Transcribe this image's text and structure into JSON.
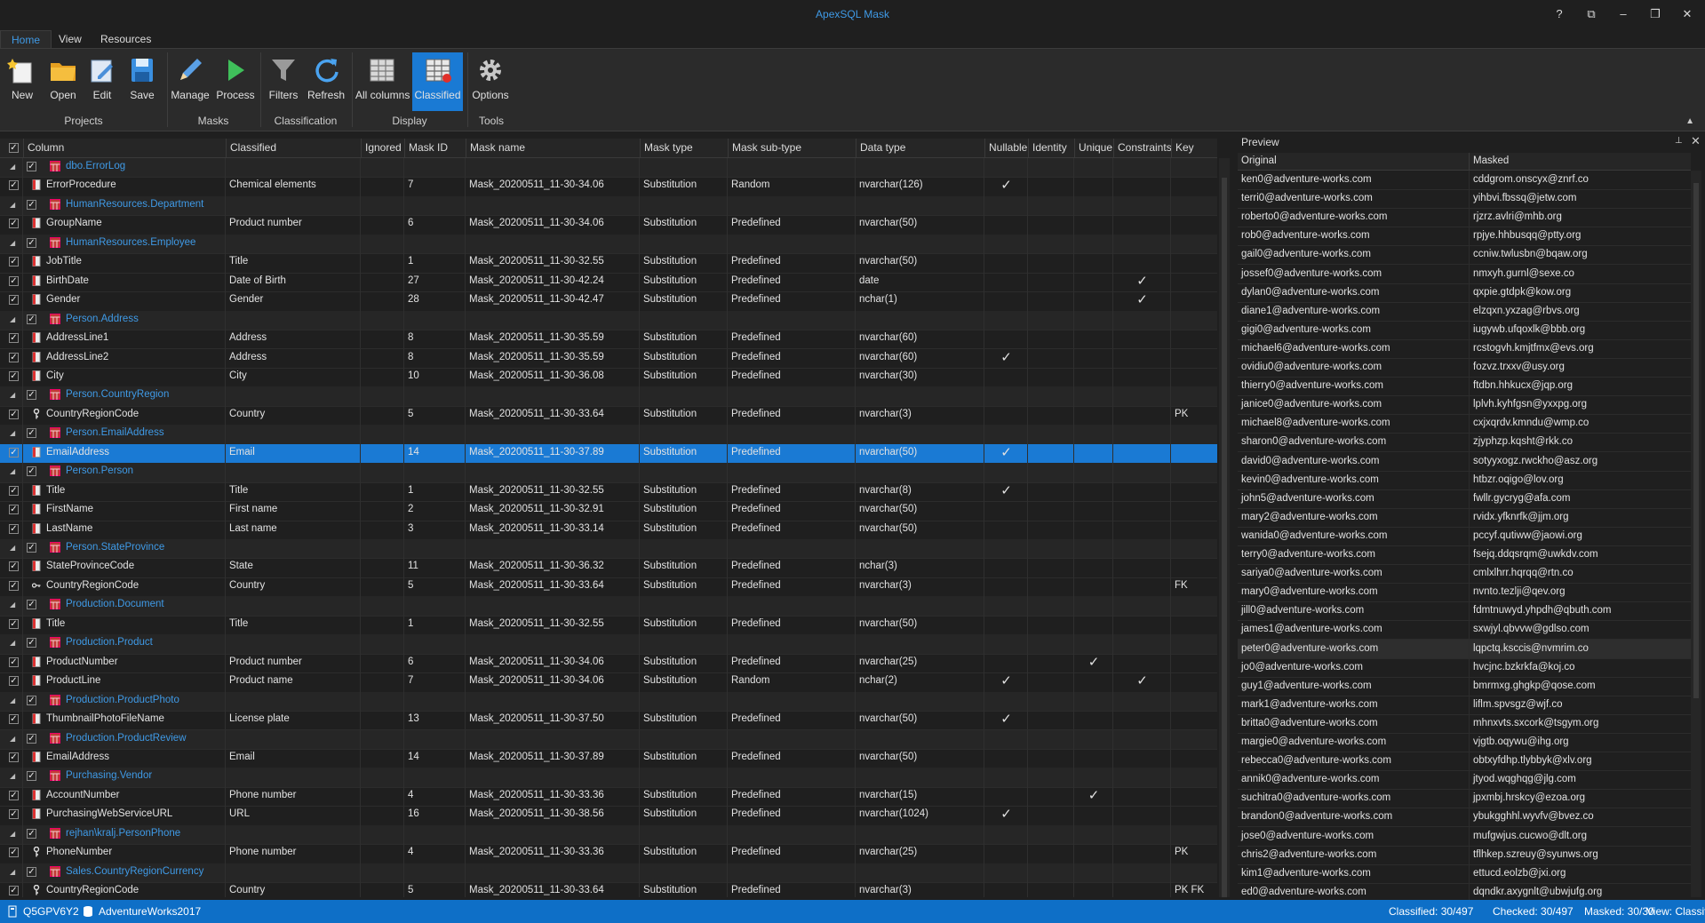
{
  "app_title": "ApexSQL Mask",
  "window_buttons": [
    "?",
    "⧉",
    "–",
    "❐",
    "✕"
  ],
  "tabs": [
    "Home",
    "View",
    "Resources"
  ],
  "ribbon": {
    "buttons": {
      "new": "New",
      "open": "Open",
      "edit": "Edit",
      "save": "Save",
      "manage": "Manage",
      "process": "Process",
      "filters": "Filters",
      "refresh": "Refresh",
      "all_columns": "All columns",
      "classified": "Classified",
      "options": "Options"
    },
    "groups": {
      "projects": "Projects",
      "masks": "Masks",
      "classification": "Classification",
      "display": "Display",
      "tools": "Tools"
    }
  },
  "grid": {
    "headers": [
      "Column",
      "Classified",
      "Ignored",
      "Mask ID",
      "Mask name",
      "Mask type",
      "Mask sub-type",
      "Data type",
      "Nullable",
      "Identity",
      "Unique",
      "Constraints",
      "Key"
    ],
    "rows": [
      {
        "group": true,
        "name": "dbo.ErrorLog"
      },
      {
        "col": "ErrorProcedure",
        "cls": "Chemical elements",
        "id": "7",
        "mask": "Mask_20200511_11-30-34.06",
        "type": "Substitution",
        "sub": "Random",
        "dt": "nvarchar(126)",
        "nullable": "✓",
        "unique": "",
        "cons": "",
        "key": "",
        "icon": "col"
      },
      {
        "group": true,
        "name": "HumanResources.Department"
      },
      {
        "col": "GroupName",
        "cls": "Product number",
        "id": "6",
        "mask": "Mask_20200511_11-30-34.06",
        "type": "Substitution",
        "sub": "Predefined",
        "dt": "nvarchar(50)",
        "nullable": "",
        "unique": "",
        "cons": "",
        "key": "",
        "icon": "col"
      },
      {
        "group": true,
        "name": "HumanResources.Employee"
      },
      {
        "col": "JobTitle",
        "cls": "Title",
        "id": "1",
        "mask": "Mask_20200511_11-30-32.55",
        "type": "Substitution",
        "sub": "Predefined",
        "dt": "nvarchar(50)",
        "nullable": "",
        "unique": "",
        "cons": "",
        "key": "",
        "icon": "col"
      },
      {
        "col": "BirthDate",
        "cls": "Date of Birth",
        "id": "27",
        "mask": "Mask_20200511_11-30-42.24",
        "type": "Substitution",
        "sub": "Predefined",
        "dt": "date",
        "nullable": "",
        "unique": "",
        "cons": "✓",
        "key": "",
        "icon": "col"
      },
      {
        "col": "Gender",
        "cls": "Gender",
        "id": "28",
        "mask": "Mask_20200511_11-30-42.47",
        "type": "Substitution",
        "sub": "Predefined",
        "dt": "nchar(1)",
        "nullable": "",
        "unique": "",
        "cons": "✓",
        "key": "",
        "icon": "col"
      },
      {
        "group": true,
        "name": "Person.Address"
      },
      {
        "col": "AddressLine1",
        "cls": "Address",
        "id": "8",
        "mask": "Mask_20200511_11-30-35.59",
        "type": "Substitution",
        "sub": "Predefined",
        "dt": "nvarchar(60)",
        "nullable": "",
        "unique": "",
        "cons": "",
        "key": "",
        "icon": "col"
      },
      {
        "col": "AddressLine2",
        "cls": "Address",
        "id": "8",
        "mask": "Mask_20200511_11-30-35.59",
        "type": "Substitution",
        "sub": "Predefined",
        "dt": "nvarchar(60)",
        "nullable": "✓",
        "unique": "",
        "cons": "",
        "key": "",
        "icon": "col"
      },
      {
        "col": "City",
        "cls": "City",
        "id": "10",
        "mask": "Mask_20200511_11-30-36.08",
        "type": "Substitution",
        "sub": "Predefined",
        "dt": "nvarchar(30)",
        "nullable": "",
        "unique": "",
        "cons": "",
        "key": "",
        "icon": "col"
      },
      {
        "group": true,
        "name": "Person.CountryRegion"
      },
      {
        "col": "CountryRegionCode",
        "cls": "Country",
        "id": "5",
        "mask": "Mask_20200511_11-30-33.64",
        "type": "Substitution",
        "sub": "Predefined",
        "dt": "nvarchar(3)",
        "nullable": "",
        "unique": "",
        "cons": "",
        "key": "PK",
        "icon": "pk"
      },
      {
        "group": true,
        "name": "Person.EmailAddress"
      },
      {
        "col": "EmailAddress",
        "cls": "Email",
        "id": "14",
        "mask": "Mask_20200511_11-30-37.89",
        "type": "Substitution",
        "sub": "Predefined",
        "dt": "nvarchar(50)",
        "nullable": "✓",
        "unique": "",
        "cons": "",
        "key": "",
        "icon": "col",
        "sel": true
      },
      {
        "group": true,
        "name": "Person.Person"
      },
      {
        "col": "Title",
        "cls": "Title",
        "id": "1",
        "mask": "Mask_20200511_11-30-32.55",
        "type": "Substitution",
        "sub": "Predefined",
        "dt": "nvarchar(8)",
        "nullable": "✓",
        "unique": "",
        "cons": "",
        "key": "",
        "icon": "col"
      },
      {
        "col": "FirstName",
        "cls": "First name",
        "id": "2",
        "mask": "Mask_20200511_11-30-32.91",
        "type": "Substitution",
        "sub": "Predefined",
        "dt": "nvarchar(50)",
        "nullable": "",
        "unique": "",
        "cons": "",
        "key": "",
        "icon": "col"
      },
      {
        "col": "LastName",
        "cls": "Last name",
        "id": "3",
        "mask": "Mask_20200511_11-30-33.14",
        "type": "Substitution",
        "sub": "Predefined",
        "dt": "nvarchar(50)",
        "nullable": "",
        "unique": "",
        "cons": "",
        "key": "",
        "icon": "col"
      },
      {
        "group": true,
        "name": "Person.StateProvince"
      },
      {
        "col": "StateProvinceCode",
        "cls": "State",
        "id": "11",
        "mask": "Mask_20200511_11-30-36.32",
        "type": "Substitution",
        "sub": "Predefined",
        "dt": "nchar(3)",
        "nullable": "",
        "unique": "",
        "cons": "",
        "key": "",
        "icon": "col"
      },
      {
        "col": "CountryRegionCode",
        "cls": "Country",
        "id": "5",
        "mask": "Mask_20200511_11-30-33.64",
        "type": "Substitution",
        "sub": "Predefined",
        "dt": "nvarchar(3)",
        "nullable": "",
        "unique": "",
        "cons": "",
        "key": "FK",
        "icon": "fk"
      },
      {
        "group": true,
        "name": "Production.Document"
      },
      {
        "col": "Title",
        "cls": "Title",
        "id": "1",
        "mask": "Mask_20200511_11-30-32.55",
        "type": "Substitution",
        "sub": "Predefined",
        "dt": "nvarchar(50)",
        "nullable": "",
        "unique": "",
        "cons": "",
        "key": "",
        "icon": "col"
      },
      {
        "group": true,
        "name": "Production.Product"
      },
      {
        "col": "ProductNumber",
        "cls": "Product number",
        "id": "6",
        "mask": "Mask_20200511_11-30-34.06",
        "type": "Substitution",
        "sub": "Predefined",
        "dt": "nvarchar(25)",
        "nullable": "",
        "unique": "✓",
        "cons": "",
        "key": "",
        "icon": "col"
      },
      {
        "col": "ProductLine",
        "cls": "Product name",
        "id": "7",
        "mask": "Mask_20200511_11-30-34.06",
        "type": "Substitution",
        "sub": "Random",
        "dt": "nchar(2)",
        "nullable": "✓",
        "unique": "",
        "cons": "✓",
        "key": "",
        "icon": "col"
      },
      {
        "group": true,
        "name": "Production.ProductPhoto"
      },
      {
        "col": "ThumbnailPhotoFileName",
        "cls": "License plate",
        "id": "13",
        "mask": "Mask_20200511_11-30-37.50",
        "type": "Substitution",
        "sub": "Predefined",
        "dt": "nvarchar(50)",
        "nullable": "✓",
        "unique": "",
        "cons": "",
        "key": "",
        "icon": "col"
      },
      {
        "group": true,
        "name": "Production.ProductReview"
      },
      {
        "col": "EmailAddress",
        "cls": "Email",
        "id": "14",
        "mask": "Mask_20200511_11-30-37.89",
        "type": "Substitution",
        "sub": "Predefined",
        "dt": "nvarchar(50)",
        "nullable": "",
        "unique": "",
        "cons": "",
        "key": "",
        "icon": "col"
      },
      {
        "group": true,
        "name": "Purchasing.Vendor"
      },
      {
        "col": "AccountNumber",
        "cls": "Phone number",
        "id": "4",
        "mask": "Mask_20200511_11-30-33.36",
        "type": "Substitution",
        "sub": "Predefined",
        "dt": "nvarchar(15)",
        "nullable": "",
        "unique": "✓",
        "cons": "",
        "key": "",
        "icon": "col"
      },
      {
        "col": "PurchasingWebServiceURL",
        "cls": "URL",
        "id": "16",
        "mask": "Mask_20200511_11-30-38.56",
        "type": "Substitution",
        "sub": "Predefined",
        "dt": "nvarchar(1024)",
        "nullable": "✓",
        "unique": "",
        "cons": "",
        "key": "",
        "icon": "col"
      },
      {
        "group": true,
        "name": "rejhan\\kralj.PersonPhone"
      },
      {
        "col": "PhoneNumber",
        "cls": "Phone number",
        "id": "4",
        "mask": "Mask_20200511_11-30-33.36",
        "type": "Substitution",
        "sub": "Predefined",
        "dt": "nvarchar(25)",
        "nullable": "",
        "unique": "",
        "cons": "",
        "key": "PK",
        "icon": "pk"
      },
      {
        "group": true,
        "name": "Sales.CountryRegionCurrency"
      },
      {
        "col": "CountryRegionCode",
        "cls": "Country",
        "id": "5",
        "mask": "Mask_20200511_11-30-33.64",
        "type": "Substitution",
        "sub": "Predefined",
        "dt": "nvarchar(3)",
        "nullable": "",
        "unique": "",
        "cons": "",
        "key": "PK FK",
        "icon": "pk"
      }
    ]
  },
  "preview": {
    "title": "Preview",
    "headers": [
      "Original",
      "Masked"
    ],
    "rows": [
      [
        "ken0@adventure-works.com",
        "cddgrom.onscyx@znrf.co"
      ],
      [
        "terri0@adventure-works.com",
        "yihbvi.fbssq@jetw.com"
      ],
      [
        "roberto0@adventure-works.com",
        "rjzrz.avlri@mhb.org"
      ],
      [
        "rob0@adventure-works.com",
        "rpjye.hhbusqq@ptty.org"
      ],
      [
        "gail0@adventure-works.com",
        "ccniw.twlusbn@bqaw.org"
      ],
      [
        "jossef0@adventure-works.com",
        "nmxyh.gurnl@sexe.co"
      ],
      [
        "dylan0@adventure-works.com",
        "qxpie.gtdpk@kow.org"
      ],
      [
        "diane1@adventure-works.com",
        "elzqxn.yxzag@rbvs.org"
      ],
      [
        "gigi0@adventure-works.com",
        "iugywb.ufqoxlk@bbb.org"
      ],
      [
        "michael6@adventure-works.com",
        "rcstogvh.kmjtfmx@evs.org"
      ],
      [
        "ovidiu0@adventure-works.com",
        "fozvz.trxxv@usy.org"
      ],
      [
        "thierry0@adventure-works.com",
        "ftdbn.hhkucx@jqp.org"
      ],
      [
        "janice0@adventure-works.com",
        "lplvh.kyhfgsn@yxxpg.org"
      ],
      [
        "michael8@adventure-works.com",
        "cxjxqrdv.kmndu@wmp.co"
      ],
      [
        "sharon0@adventure-works.com",
        "zjyphzp.kqsht@rkk.co"
      ],
      [
        "david0@adventure-works.com",
        "sotyyxogz.rwckho@asz.org"
      ],
      [
        "kevin0@adventure-works.com",
        "htbzr.oqigo@lov.org"
      ],
      [
        "john5@adventure-works.com",
        "fwllr.gycryg@afa.com"
      ],
      [
        "mary2@adventure-works.com",
        "rvidx.yfknrfk@jjm.org"
      ],
      [
        "wanida0@adventure-works.com",
        "pccyf.qutiww@jaowi.org"
      ],
      [
        "terry0@adventure-works.com",
        "fsejq.ddqsrqm@uwkdv.com"
      ],
      [
        "sariya0@adventure-works.com",
        "cmlxlhrr.hqrqq@rtn.co"
      ],
      [
        "mary0@adventure-works.com",
        "nvnto.tezlji@qev.org"
      ],
      [
        "jill0@adventure-works.com",
        "fdmtnuwyd.yhpdh@qbuth.com"
      ],
      [
        "james1@adventure-works.com",
        "sxwjyl.qbvvw@gdlso.com"
      ],
      [
        "peter0@adventure-works.com",
        "lqpctq.ksccis@nvmrim.co"
      ],
      [
        "jo0@adventure-works.com",
        "hvcjnc.bzkrkfa@koj.co"
      ],
      [
        "guy1@adventure-works.com",
        "bmrmxg.ghgkp@qose.com"
      ],
      [
        "mark1@adventure-works.com",
        "liflm.spvsgz@wjf.co"
      ],
      [
        "britta0@adventure-works.com",
        "mhnxvts.sxcork@tsgym.org"
      ],
      [
        "margie0@adventure-works.com",
        "vjgtb.oqywu@ihg.org"
      ],
      [
        "rebecca0@adventure-works.com",
        "obtxyfdhp.tlybbyk@xlv.org"
      ],
      [
        "annik0@adventure-works.com",
        "jtyod.wqghqg@jlg.com"
      ],
      [
        "suchitra0@adventure-works.com",
        "jpxmbj.hrskcy@ezoa.org"
      ],
      [
        "brandon0@adventure-works.com",
        "ybukgghhl.wyvfv@bvez.co"
      ],
      [
        "jose0@adventure-works.com",
        "mufgwjus.cucwo@dlt.org"
      ],
      [
        "chris2@adventure-works.com",
        "tflhkep.szreuy@syunws.org"
      ],
      [
        "kim1@adventure-works.com",
        "ettucd.eolzb@jxi.org"
      ],
      [
        "ed0@adventure-works.com",
        "dqndkr.axygnlt@ubwjufg.org"
      ]
    ]
  },
  "status": {
    "server": "Q5GPV6Y2",
    "database": "AdventureWorks2017",
    "classified": "Classified: 30/497",
    "checked": "Checked: 30/497",
    "masked": "Masked: 30/30",
    "view": "View: Classified"
  },
  "colors": {
    "accent": "#1a7ad4",
    "link": "#3f9ae6",
    "bg": "#1f1f1f",
    "status": "#0e6fc7"
  }
}
